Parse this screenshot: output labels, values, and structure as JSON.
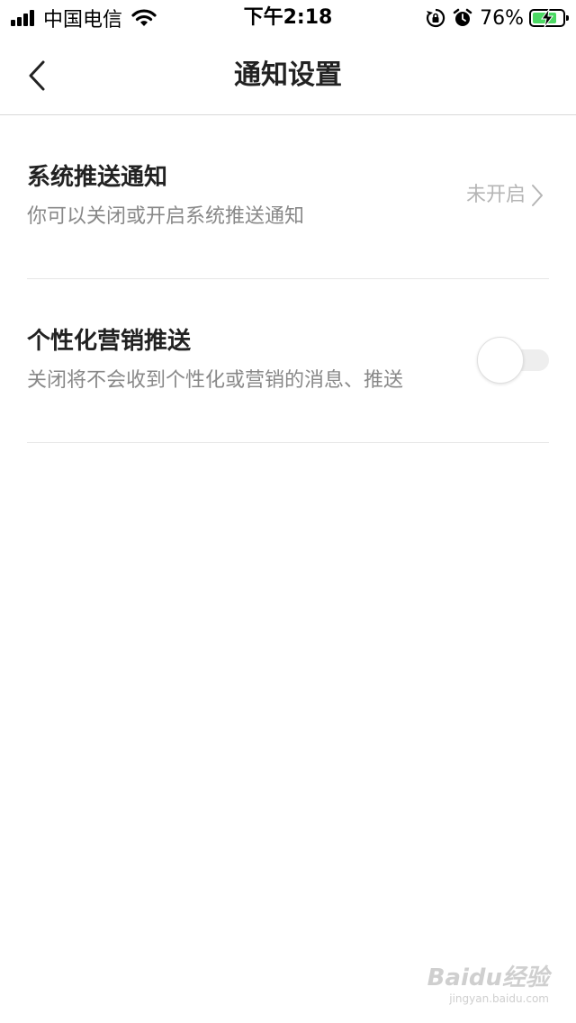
{
  "status_bar": {
    "carrier": "中国电信",
    "time": "下午2:18",
    "battery_percent": "76%",
    "icons": [
      "signal-icon",
      "wifi-icon",
      "rotation-lock-icon",
      "alarm-icon",
      "battery-charging-icon"
    ]
  },
  "nav": {
    "title": "通知设置",
    "back_icon": "chevron-left-icon"
  },
  "settings": [
    {
      "title": "系统推送通知",
      "desc": "你可以关闭或开启系统推送通知",
      "value": "未开启"
    },
    {
      "title": "个性化营销推送",
      "desc": "关闭将不会收到个性化或营销的消息、推送",
      "enabled": false
    }
  ],
  "watermark": {
    "brand": "Baidu经验",
    "url": "jingyan.baidu.com"
  },
  "colors": {
    "battery_fill": "#4cd964",
    "divider": "#e6e6e6",
    "secondary_text": "#888888",
    "value_text": "#b5b5b5"
  }
}
